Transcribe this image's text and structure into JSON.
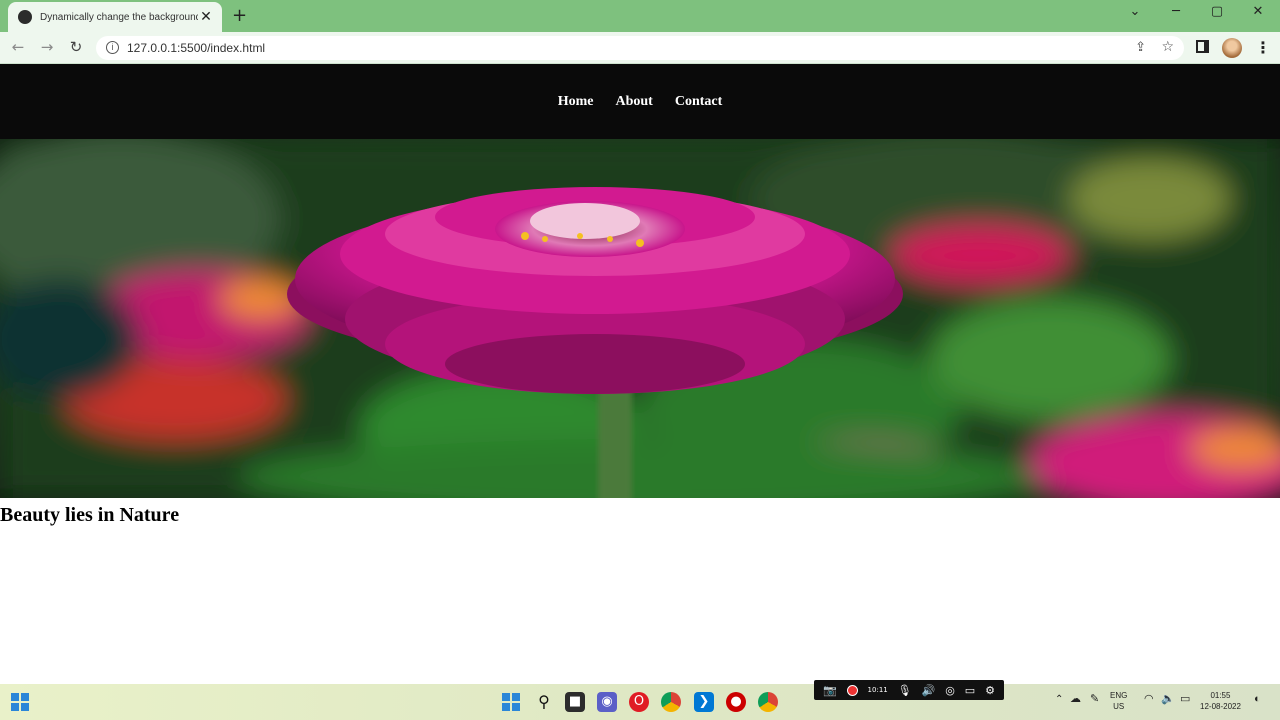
{
  "browser": {
    "tab_title": "Dynamically change the background",
    "tab_close": "✕",
    "new_tab": "+",
    "url": "127.0.0.1:5500/index.html",
    "window_controls": {
      "dropdown": "⌄",
      "minimize": "─",
      "maximize": "▢",
      "close": "✕"
    },
    "nav_icons": {
      "back": "arrow-left-icon",
      "forward": "arrow-right-icon",
      "reload": "reload-icon"
    }
  },
  "page": {
    "nav_items": [
      "Home",
      "About",
      "Contact"
    ],
    "heading": "Beauty lies in Nature",
    "hero_image": "magenta-zinnia-flower-image"
  },
  "recorder": {
    "time": "10:11"
  },
  "taskbar": {
    "apps": [
      "windows-start-icon",
      "search-icon",
      "file-explorer-icon",
      "teams-icon",
      "opera-icon",
      "chrome-icon",
      "vscode-icon",
      "recorder-icon",
      "chrome-active-icon"
    ],
    "lang_top": "ENG",
    "lang_bottom": "US",
    "time": "01:55",
    "date": "12-08-2022"
  },
  "colors": {
    "tabstrip": "#7ec17e",
    "toolbar": "#eef7ee",
    "nav_bg": "#0a0a0a",
    "flower": "#c8168c"
  }
}
